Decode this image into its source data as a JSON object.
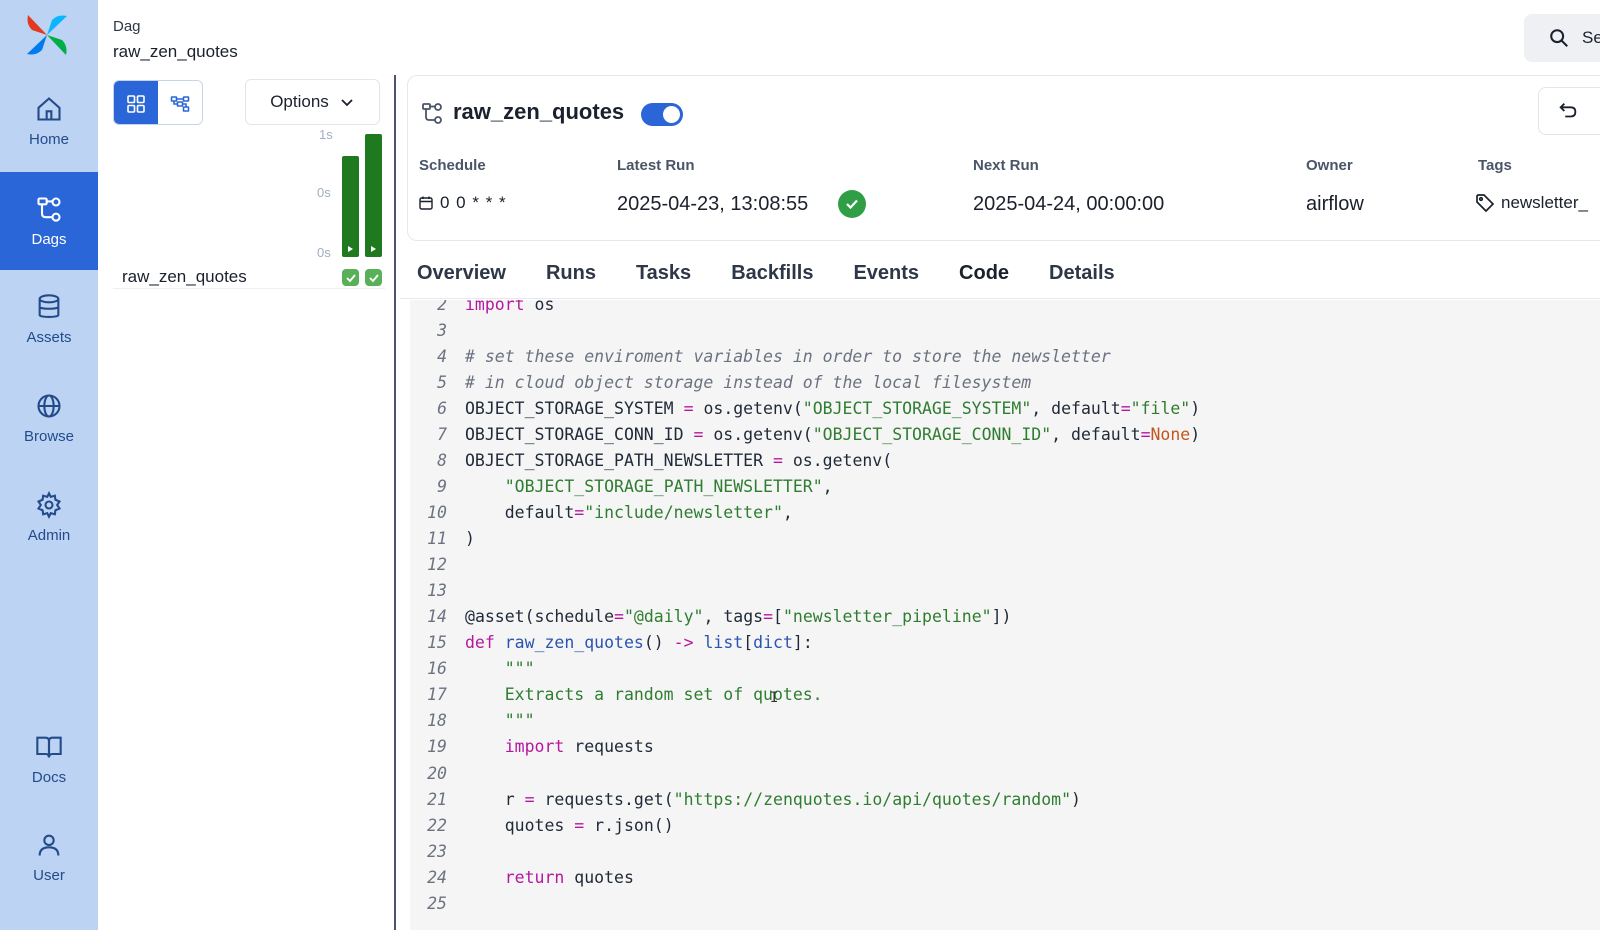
{
  "nav": {
    "items": [
      {
        "label": "Home",
        "icon": "home-icon"
      },
      {
        "label": "Dags",
        "icon": "dag-icon",
        "active": true
      },
      {
        "label": "Assets",
        "icon": "database-icon"
      },
      {
        "label": "Browse",
        "icon": "globe-icon"
      },
      {
        "label": "Admin",
        "icon": "gear-icon"
      },
      {
        "label": "Docs",
        "icon": "book-icon"
      },
      {
        "label": "User",
        "icon": "user-icon"
      }
    ]
  },
  "header": {
    "crumb": "Dag",
    "dag_id": "raw_zen_quotes",
    "search_label": "Se"
  },
  "grid": {
    "options_label": "Options",
    "ticks": [
      "1s",
      "0s",
      "0s"
    ],
    "dag_name": "raw_zen_quotes",
    "runs": [
      {
        "duration_fraction": 0.82,
        "state": "success"
      },
      {
        "duration_fraction": 1.0,
        "state": "success"
      }
    ]
  },
  "dag": {
    "title": "raw_zen_quotes",
    "enabled": true,
    "schedule_label": "Schedule",
    "schedule": "0 0 * * *",
    "latest_run_label": "Latest Run",
    "latest_run": "2025-04-23, 13:08:55",
    "next_run_label": "Next Run",
    "next_run": "2025-04-24, 00:00:00",
    "owner_label": "Owner",
    "owner": "airflow",
    "tags_label": "Tags",
    "tag": "newsletter_"
  },
  "tabs": [
    "Overview",
    "Runs",
    "Tasks",
    "Backfills",
    "Events",
    "Code",
    "Details"
  ],
  "active_tab": "Code",
  "colors": {
    "accent": "#2a66d8",
    "nav_bg": "#bdd3f4",
    "success": "#2f9e44",
    "keyword": "#b5179e",
    "string": "#2f7d31"
  },
  "code": {
    "lines": [
      {
        "n": "2",
        "t": "import os"
      },
      {
        "n": "3",
        "t": ""
      },
      {
        "n": "4",
        "t": "# set these enviroment variables in order to store the newsletter"
      },
      {
        "n": "5",
        "t": "# in cloud object storage instead of the local filesystem"
      },
      {
        "n": "6",
        "t": "OBJECT_STORAGE_SYSTEM = os.getenv(\"OBJECT_STORAGE_SYSTEM\", default=\"file\")"
      },
      {
        "n": "7",
        "t": "OBJECT_STORAGE_CONN_ID = os.getenv(\"OBJECT_STORAGE_CONN_ID\", default=None)"
      },
      {
        "n": "8",
        "t": "OBJECT_STORAGE_PATH_NEWSLETTER = os.getenv("
      },
      {
        "n": "9",
        "t": "    \"OBJECT_STORAGE_PATH_NEWSLETTER\","
      },
      {
        "n": "10",
        "t": "    default=\"include/newsletter\","
      },
      {
        "n": "11",
        "t": ")"
      },
      {
        "n": "12",
        "t": ""
      },
      {
        "n": "13",
        "t": ""
      },
      {
        "n": "14",
        "t": "@asset(schedule=\"@daily\", tags=[\"newsletter_pipeline\"])"
      },
      {
        "n": "15",
        "t": "def raw_zen_quotes() -> list[dict]:"
      },
      {
        "n": "16",
        "t": "    \"\"\""
      },
      {
        "n": "17",
        "t": "    Extracts a random set of quotes."
      },
      {
        "n": "18",
        "t": "    \"\"\""
      },
      {
        "n": "19",
        "t": "    import requests"
      },
      {
        "n": "20",
        "t": ""
      },
      {
        "n": "21",
        "t": "    r = requests.get(\"https://zenquotes.io/api/quotes/random\")"
      },
      {
        "n": "22",
        "t": "    quotes = r.json()"
      },
      {
        "n": "23",
        "t": ""
      },
      {
        "n": "24",
        "t": "    return quotes"
      },
      {
        "n": "25",
        "t": ""
      }
    ]
  }
}
